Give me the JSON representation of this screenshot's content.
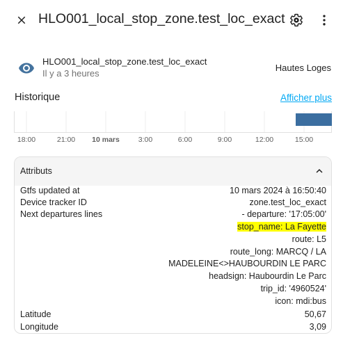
{
  "header": {
    "title": "HLO001_local_stop_zone.test_loc_exact",
    "close_icon": "close-icon",
    "settings_icon": "gear-icon",
    "more_icon": "dots-vertical-icon"
  },
  "state": {
    "entity_name": "HLO001_local_stop_zone.test_loc_exact",
    "time_ago": "Il y a 3 heures",
    "value": "Hautes Loges",
    "icon": "eye-icon",
    "icon_color": "#44739e"
  },
  "history": {
    "title": "Historique",
    "show_more": "Afficher plus",
    "bar_color": "#3b6ea0",
    "link_color": "#03a9f4",
    "ticks": [
      "18:00",
      "21:00",
      "10 mars",
      "3:00",
      "6:00",
      "9:00",
      "12:00",
      "15:00"
    ],
    "bold_tick": "10 mars"
  },
  "attributes": {
    "title": "Attributs",
    "rows": [
      {
        "label": "Gtfs updated at",
        "value": "10 mars 2024 à 16:50:40"
      },
      {
        "label": "Device tracker ID",
        "value": "zone.test_loc_exact"
      },
      {
        "label": "Next departures lines",
        "value": "- departure: '17:05:00'"
      },
      {
        "label": "",
        "value": "stop_name: La Fayette",
        "highlight": true
      },
      {
        "label": "",
        "value": "route: L5"
      },
      {
        "label": "",
        "value": "route_long: MARCQ / LA"
      },
      {
        "label": "",
        "value": "MADELEINE<>HAUBOURDIN LE PARC"
      },
      {
        "label": "",
        "value": "headsign: Haubourdin Le Parc"
      },
      {
        "label": "",
        "value": "trip_id: '4960524'"
      },
      {
        "label": "",
        "value": "icon: mdi:bus"
      },
      {
        "label": "Latitude",
        "value": "50,67"
      },
      {
        "label": "Longitude",
        "value": "3,09"
      }
    ]
  }
}
